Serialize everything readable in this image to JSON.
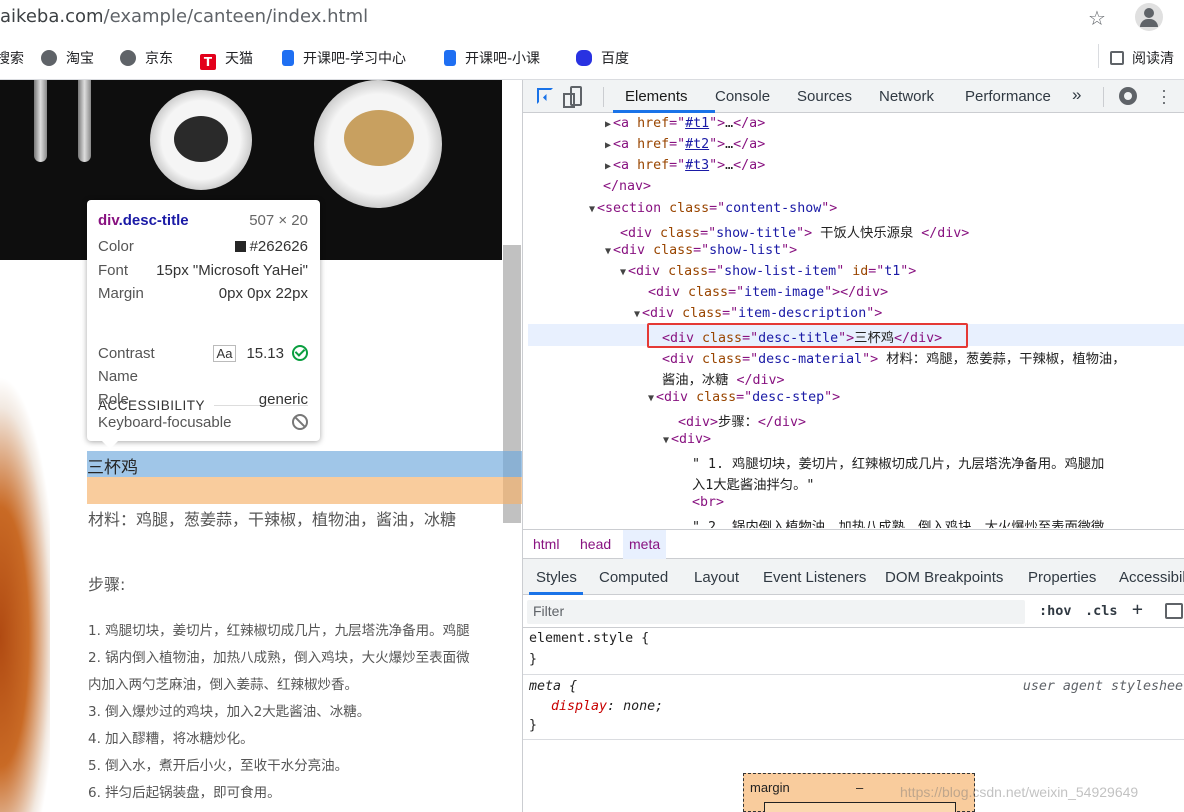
{
  "address_bar": {
    "url_domain": "aikeba.com",
    "url_path": "/example/canteen/index.html"
  },
  "bookmarks": [
    {
      "label": "搜索",
      "icon": "search-engine-icon"
    },
    {
      "label": "淘宝",
      "icon": "globe-icon"
    },
    {
      "label": "京东",
      "icon": "globe-icon"
    },
    {
      "label": "天猫",
      "icon": "tmall-icon",
      "icon_text": "T"
    },
    {
      "label": "开课吧-学习中心",
      "icon": "kaikeba-icon"
    },
    {
      "label": "开课吧-小课",
      "icon": "kaikeba-icon"
    },
    {
      "label": "百度",
      "icon": "baidu-icon"
    }
  ],
  "reading_list": "阅读清",
  "page": {
    "title": "三杯鸡",
    "material": "材料：鸡腿，葱姜蒜，干辣椒，植物油，酱油，冰糖",
    "steps_heading": "步骤:",
    "steps": [
      "1. 鸡腿切块，姜切片，红辣椒切成几片，九层塔洗净备用。鸡腿",
      "2. 锅内倒入植物油，加热八成熟，倒入鸡块，大火爆炒至表面微",
      "内加入两勺芝麻油，倒入姜蒜、红辣椒炒香。",
      "3. 倒入爆炒过的鸡块，加入2大匙酱油、冰糖。",
      "4. 加入醪糟，将冰糖炒化。",
      "5. 倒入水，煮开后小火，至收干水分亮油。",
      "6. 拌匀后起锅装盘，即可食用。"
    ]
  },
  "tooltip": {
    "tag": "div",
    "class": ".desc-title",
    "size": "507 × 20",
    "color_label": "Color",
    "color_value": "#262626",
    "font_label": "Font",
    "font_value": "15px \"Microsoft YaHei\"",
    "margin_label": "Margin",
    "margin_value": "0px 0px 22px",
    "section": "ACCESSIBILITY",
    "contrast_label": "Contrast",
    "contrast_aa": "Aa",
    "contrast_value": "15.13",
    "name_label": "Name",
    "role_label": "Role",
    "role_value": "generic",
    "kbd_label": "Keyboard-focusable"
  },
  "devtools": {
    "tabs": [
      "Elements",
      "Console",
      "Sources",
      "Network",
      "Performance",
      "»"
    ],
    "active_tab": "Elements",
    "breadcrumbs": [
      "html",
      "head",
      "meta"
    ],
    "style_tabs": [
      "Styles",
      "Computed",
      "Layout",
      "Event Listeners",
      "DOM Breakpoints",
      "Properties",
      "Accessibili"
    ],
    "filter_placeholder": "Filter",
    "hov": ":hov",
    "cls": ".cls",
    "plus": "+",
    "dom": {
      "a1": {
        "href": "#t1"
      },
      "a2": {
        "href": "#t2"
      },
      "a3": {
        "href": "#t3"
      },
      "nav_close": "</nav>",
      "section_class": "content-show",
      "show_title_class": "show-title",
      "show_title_text": " 干饭人快乐源泉 ",
      "show_list_class": "show-list",
      "item_class": "show-list-item",
      "item_id": "t1",
      "item_image_class": "item-image",
      "item_desc_class": "item-description",
      "desc_title_class": "desc-title",
      "desc_title_text": "三杯鸡",
      "desc_material_class": "desc-material",
      "desc_material_text": " 材料：鸡腿，葱姜蒜，干辣椒，植物油，",
      "desc_material_cont": "酱油，冰糖 ",
      "desc_step_class": "desc-step",
      "step_heading": "步骤：",
      "text1a": "\" 1. 鸡腿切块，姜切片，红辣椒切成几片，九层塔洗净备用。鸡腿加",
      "text1b": "入1大匙酱油拌匀。\"",
      "br": "<br>",
      "text2": "\" 2. 锅内倒入植物油，加热八成熟，倒入鸡块，大火爆炒至表面微微"
    },
    "rules": {
      "element_style": "element.style {",
      "close": "}",
      "meta_selector": "meta {",
      "ua_label": "user agent styleshee",
      "prop": "display",
      "value": "none;"
    },
    "boxmodel": {
      "label": "margin",
      "value": "–"
    }
  },
  "watermark": "https://blog.csdn.net/weixin_54929649"
}
